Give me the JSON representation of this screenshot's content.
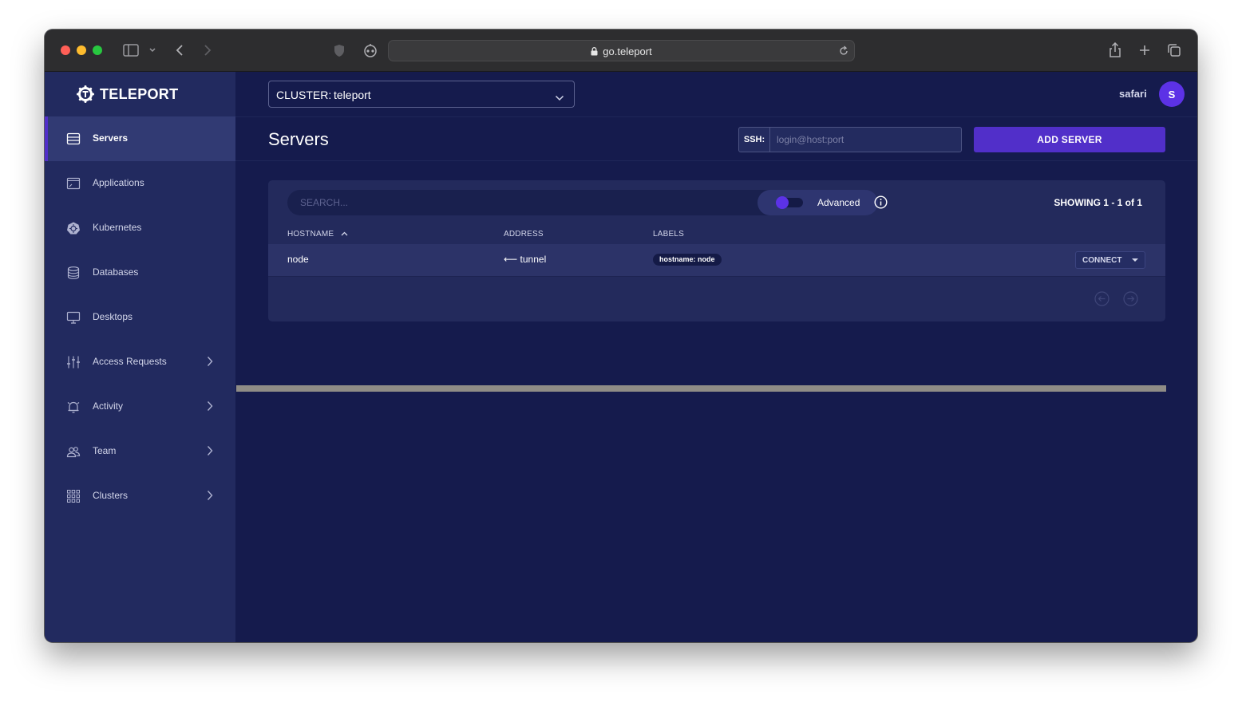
{
  "browser": {
    "url": "go.teleport"
  },
  "brand": {
    "name": "TELEPORT"
  },
  "sidebar": {
    "items": [
      {
        "label": "Servers",
        "icon": "server-icon",
        "active": true
      },
      {
        "label": "Applications",
        "icon": "application-icon"
      },
      {
        "label": "Kubernetes",
        "icon": "kubernetes-icon"
      },
      {
        "label": "Databases",
        "icon": "database-icon"
      },
      {
        "label": "Desktops",
        "icon": "desktop-icon"
      },
      {
        "label": "Access Requests",
        "icon": "sliders-icon",
        "expandable": true
      },
      {
        "label": "Activity",
        "icon": "bell-icon",
        "expandable": true
      },
      {
        "label": "Team",
        "icon": "team-icon",
        "expandable": true
      },
      {
        "label": "Clusters",
        "icon": "grid-icon",
        "expandable": true
      }
    ]
  },
  "topbar": {
    "cluster_label": "CLUSTER:",
    "cluster_value": "teleport",
    "user_name": "safari",
    "avatar_initial": "S"
  },
  "header": {
    "title": "Servers",
    "ssh_label": "SSH:",
    "ssh_placeholder": "login@host:port",
    "add_button": "ADD SERVER"
  },
  "table": {
    "search_placeholder": "SEARCH...",
    "advanced_label": "Advanced",
    "advanced_on": false,
    "showing_text": "SHOWING 1 - 1 of 1",
    "columns": [
      "HOSTNAME",
      "ADDRESS",
      "LABELS"
    ],
    "sort_column": "HOSTNAME",
    "rows": [
      {
        "hostname": "node",
        "address": "⟵ tunnel",
        "labels": [
          "hostname: node"
        ],
        "action": "CONNECT"
      }
    ]
  },
  "colors": {
    "primary": "#512fc9",
    "background": "#151b4d",
    "sidebar": "#222a5f",
    "card": "#232a5c"
  }
}
